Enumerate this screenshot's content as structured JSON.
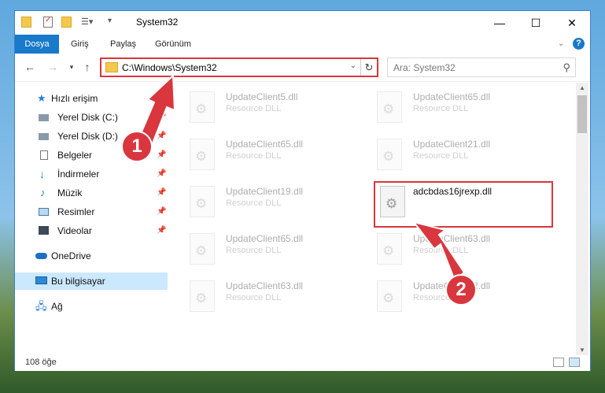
{
  "window": {
    "title": "System32"
  },
  "ribbon": {
    "tabs": [
      "Dosya",
      "Giriş",
      "Paylaş",
      "Görünüm"
    ]
  },
  "nav": {
    "address": "C:\\Windows\\System32",
    "search_placeholder": "Ara: System32"
  },
  "sidebar": {
    "items": [
      {
        "label": "Hızlı erişim",
        "icon": "star-icon"
      },
      {
        "label": "Yerel Disk (C:)",
        "icon": "drive-icon"
      },
      {
        "label": "Yerel Disk (D:)",
        "icon": "drive-icon"
      },
      {
        "label": "Belgeler",
        "icon": "document-icon"
      },
      {
        "label": "İndirmeler",
        "icon": "download-icon"
      },
      {
        "label": "Müzik",
        "icon": "music-icon"
      },
      {
        "label": "Resimler",
        "icon": "pictures-icon"
      },
      {
        "label": "Videolar",
        "icon": "video-icon"
      },
      {
        "label": "OneDrive",
        "icon": "cloud-icon"
      },
      {
        "label": "Bu bilgisayar",
        "icon": "computer-icon"
      },
      {
        "label": "Ağ",
        "icon": "network-icon"
      }
    ]
  },
  "files": [
    {
      "name": "UpdateClient5.dll",
      "type": "Resource DLL"
    },
    {
      "name": "UpdateClient65.dll",
      "type": "Resource DLL"
    },
    {
      "name": "UpdateClient65.dll",
      "type": "Resource DLL"
    },
    {
      "name": "UpdateClient21.dll",
      "type": "Resource DLL"
    },
    {
      "name": "UpdateClient19.dll",
      "type": "Resource DLL"
    },
    {
      "name": "adcbdas16jrexp.dll",
      "type": ""
    },
    {
      "name": "UpdateClient65.dll",
      "type": "Resource DLL"
    },
    {
      "name": "UpdateClient63.dll",
      "type": "Resource DLL"
    },
    {
      "name": "UpdateClient63.dll",
      "type": "Resource DLL"
    },
    {
      "name": "UpdateClient42.dll",
      "type": "Resource DLL"
    }
  ],
  "status": {
    "count": "108 öğe"
  },
  "badges": {
    "one": "1",
    "two": "2"
  },
  "colors": {
    "accent": "#1979ca",
    "highlight": "#d9363e"
  }
}
